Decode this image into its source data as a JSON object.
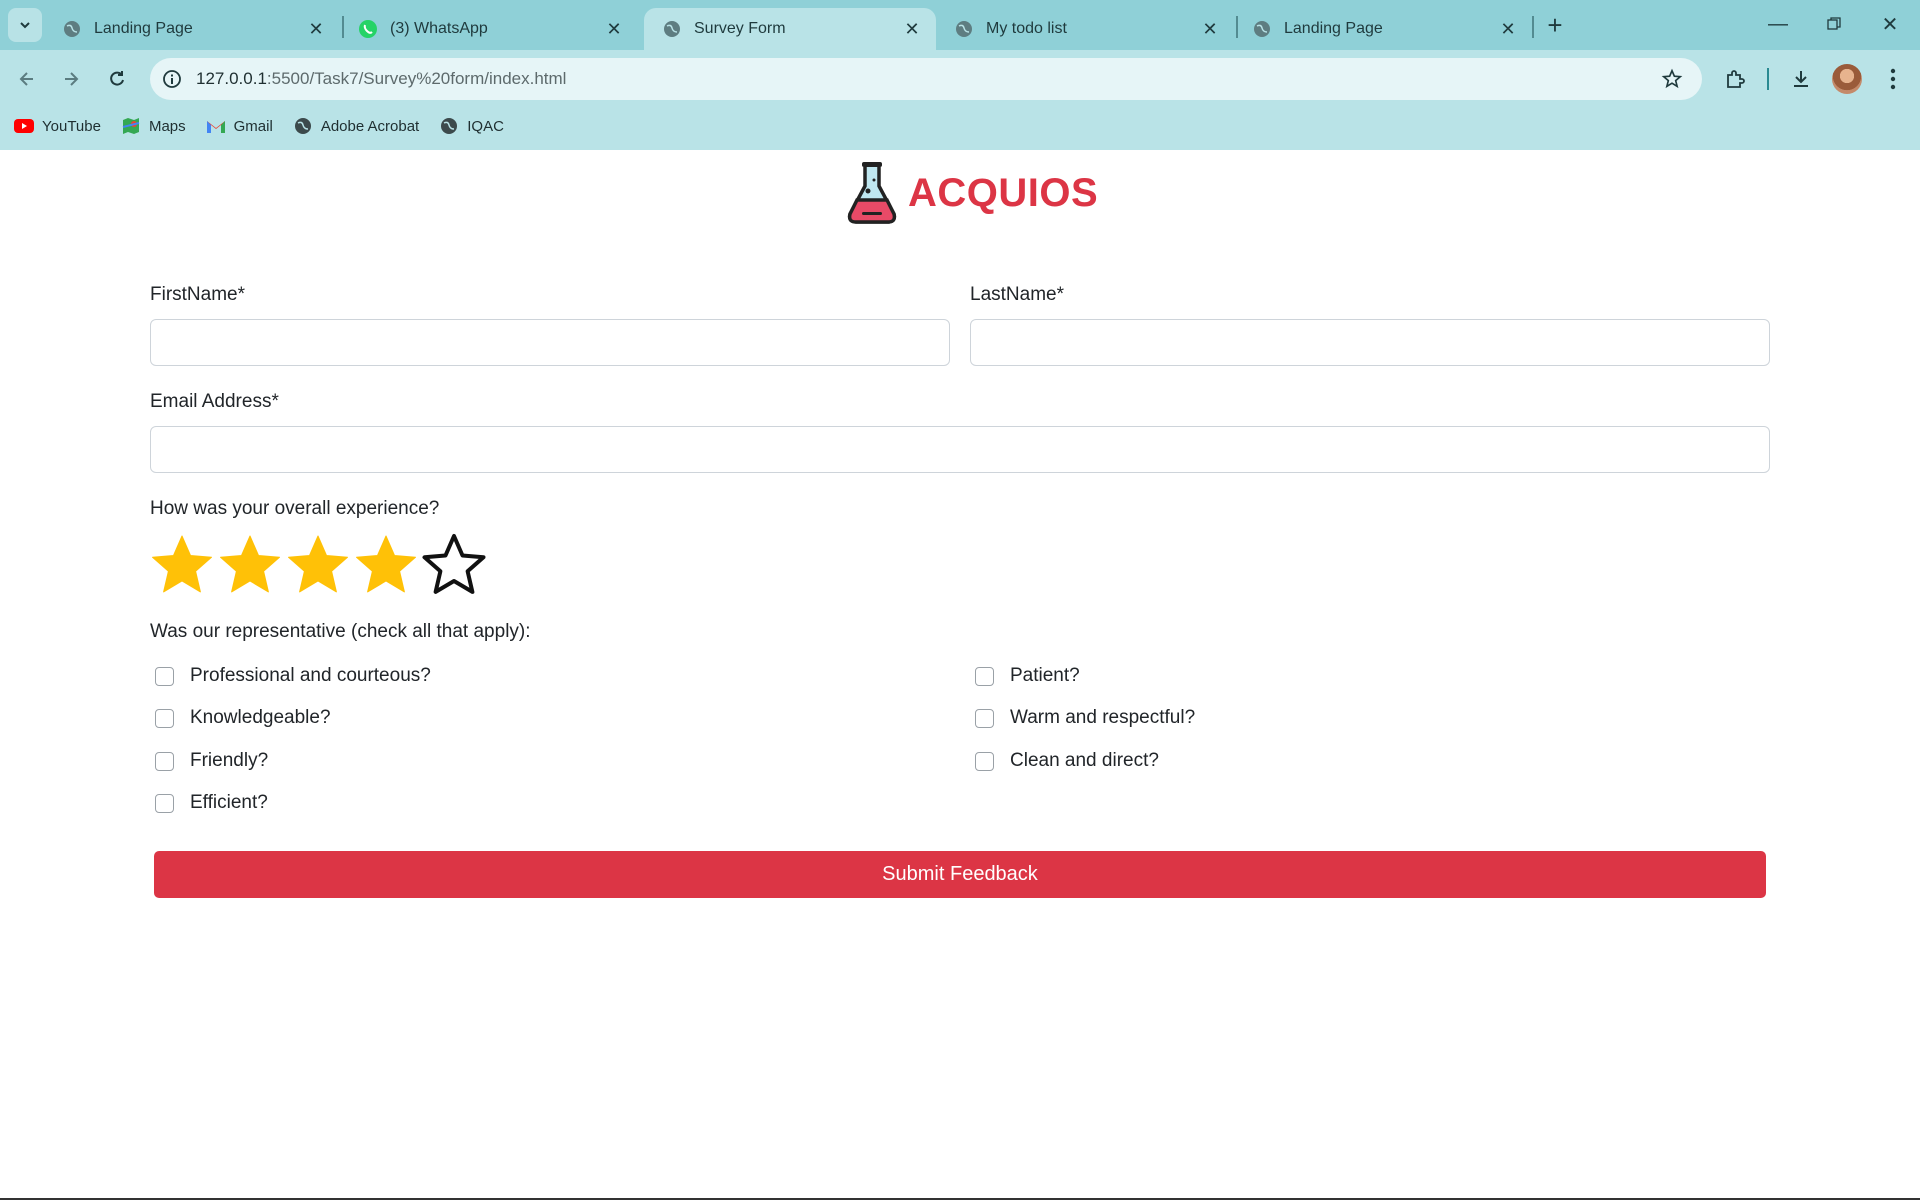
{
  "browser": {
    "tabs": [
      {
        "title": "Landing Page",
        "active": false
      },
      {
        "title": "(3) WhatsApp",
        "active": false
      },
      {
        "title": "Survey Form",
        "active": true
      },
      {
        "title": "My todo list",
        "active": false
      },
      {
        "title": "Landing Page",
        "active": false
      }
    ],
    "url": {
      "host": "127.0.0.1",
      "path": ":5500/Task7/Survey%20form/index.html"
    },
    "bookmarks": [
      "YouTube",
      "Maps",
      "Gmail",
      "Adobe Acrobat",
      "IQAC"
    ]
  },
  "brand": {
    "name": "ACQUIOS",
    "color": "#dc3545"
  },
  "form": {
    "first_name_label": "FirstName*",
    "first_name_value": "",
    "last_name_label": "LastName*",
    "last_name_value": "",
    "email_label": "Email Address*",
    "email_value": "",
    "rating_question": "How was your overall experience?",
    "rating": {
      "value": 4,
      "max": 5
    },
    "checklist_question": "Was our representative (check all that apply):",
    "checklist_left": [
      "Professional and courteous?",
      "Knowledgeable?",
      "Friendly?",
      "Efficient?"
    ],
    "checklist_right": [
      "Patient?",
      "Warm and respectful?",
      "Clean and direct?"
    ],
    "submit_label": "Submit Feedback"
  },
  "colors": {
    "tabbar": "#8fd0d7",
    "toolbar": "#b9e3e7",
    "accent": "#dc3545",
    "star": "#ffc107"
  },
  "icons": [
    "tab-list-icon",
    "globe-icon",
    "whatsapp-icon",
    "close-icon",
    "plus-icon",
    "minimize-icon",
    "restore-icon",
    "back-icon",
    "forward-icon",
    "reload-icon",
    "site-info-icon",
    "bookmark-star-icon",
    "extensions-icon",
    "download-icon",
    "more-icon",
    "flask-icon",
    "star-icon"
  ]
}
